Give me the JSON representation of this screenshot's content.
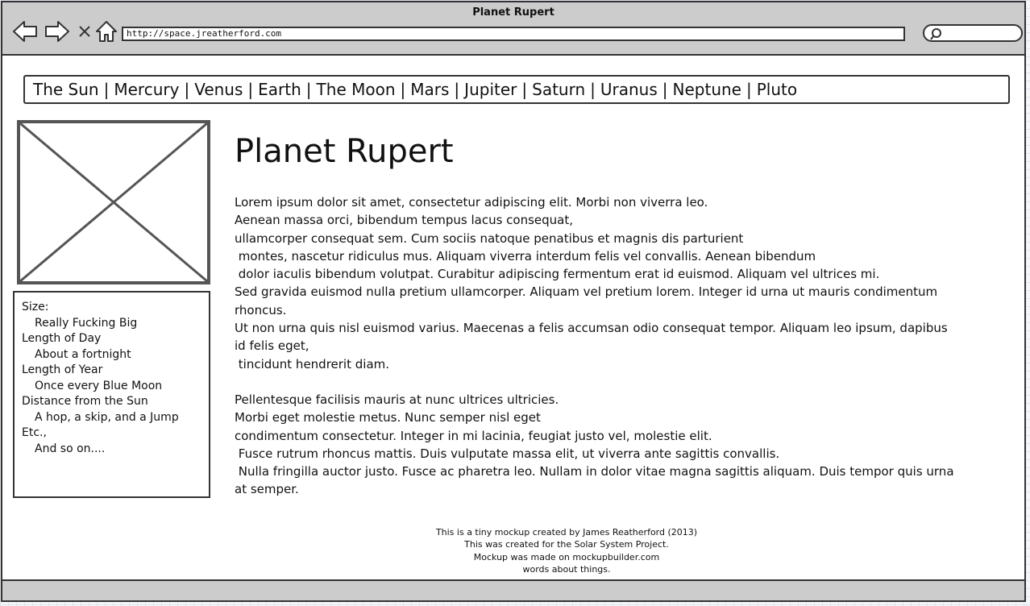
{
  "window": {
    "title": "Planet Rupert"
  },
  "toolbar": {
    "back_icon": "arrow-left-icon",
    "forward_icon": "arrow-right-icon",
    "stop_icon": "close-icon",
    "home_icon": "home-icon",
    "url": "http://space.jreatherford.com",
    "search_icon": "search-icon"
  },
  "nav": {
    "separator": "|",
    "items": [
      "The Sun",
      "Mercury",
      "Venus",
      "Earth",
      "The Moon",
      "Mars",
      "Jupiter",
      "Saturn",
      "Uranus",
      "Neptune",
      "Pluto"
    ]
  },
  "sidebar": {
    "image_placeholder_icon": "image-placeholder-icon",
    "facts": [
      {
        "label": "Size:",
        "value": "Really Fucking Big"
      },
      {
        "label": "Length of Day",
        "value": "About a fortnight"
      },
      {
        "label": "Length of Year",
        "value": "Once every Blue Moon"
      },
      {
        "label": "Distance from the Sun",
        "value": "A hop, a skip, and a Jump"
      },
      {
        "label": "Etc.,",
        "value": "And so on...."
      }
    ]
  },
  "main": {
    "title": "Planet Rupert",
    "paragraph1": "Lorem ipsum dolor sit amet, consectetur adipiscing elit. Morbi non viverra leo.\nAenean massa orci, bibendum tempus lacus consequat,\nullamcorper consequat sem. Cum sociis natoque penatibus et magnis dis parturient\n montes, nascetur ridiculus mus. Aliquam viverra interdum felis vel convallis. Aenean bibendum\n dolor iaculis bibendum volutpat. Curabitur adipiscing fermentum erat id euismod. Aliquam vel ultrices mi.\nSed gravida euismod nulla pretium ullamcorper. Aliquam vel pretium lorem. Integer id urna ut mauris condimentum rhoncus.\nUt non urna quis nisl euismod varius. Maecenas a felis accumsan odio consequat tempor. Aliquam leo ipsum, dapibus id felis eget,\n tincidunt hendrerit diam.",
    "paragraph2": "Pellentesque facilisis mauris at nunc ultrices ultricies.\nMorbi eget molestie metus. Nunc semper nisl eget\ncondimentum consectetur. Integer in mi lacinia, feugiat justo vel, molestie elit.\n Fusce rutrum rhoncus mattis. Duis vulputate massa elit, ut viverra ante sagittis convallis.\n Nulla fringilla auctor justo. Fusce ac pharetra leo. Nullam in dolor vitae magna sagittis aliquam. Duis tempor quis urna at semper."
  },
  "footer": {
    "lines": [
      "This is a tiny mockup created by James Reatherford (2013)",
      "This was created for the Solar System Project.",
      "Mockup was made on mockupbuilder.com",
      "words about things."
    ]
  }
}
